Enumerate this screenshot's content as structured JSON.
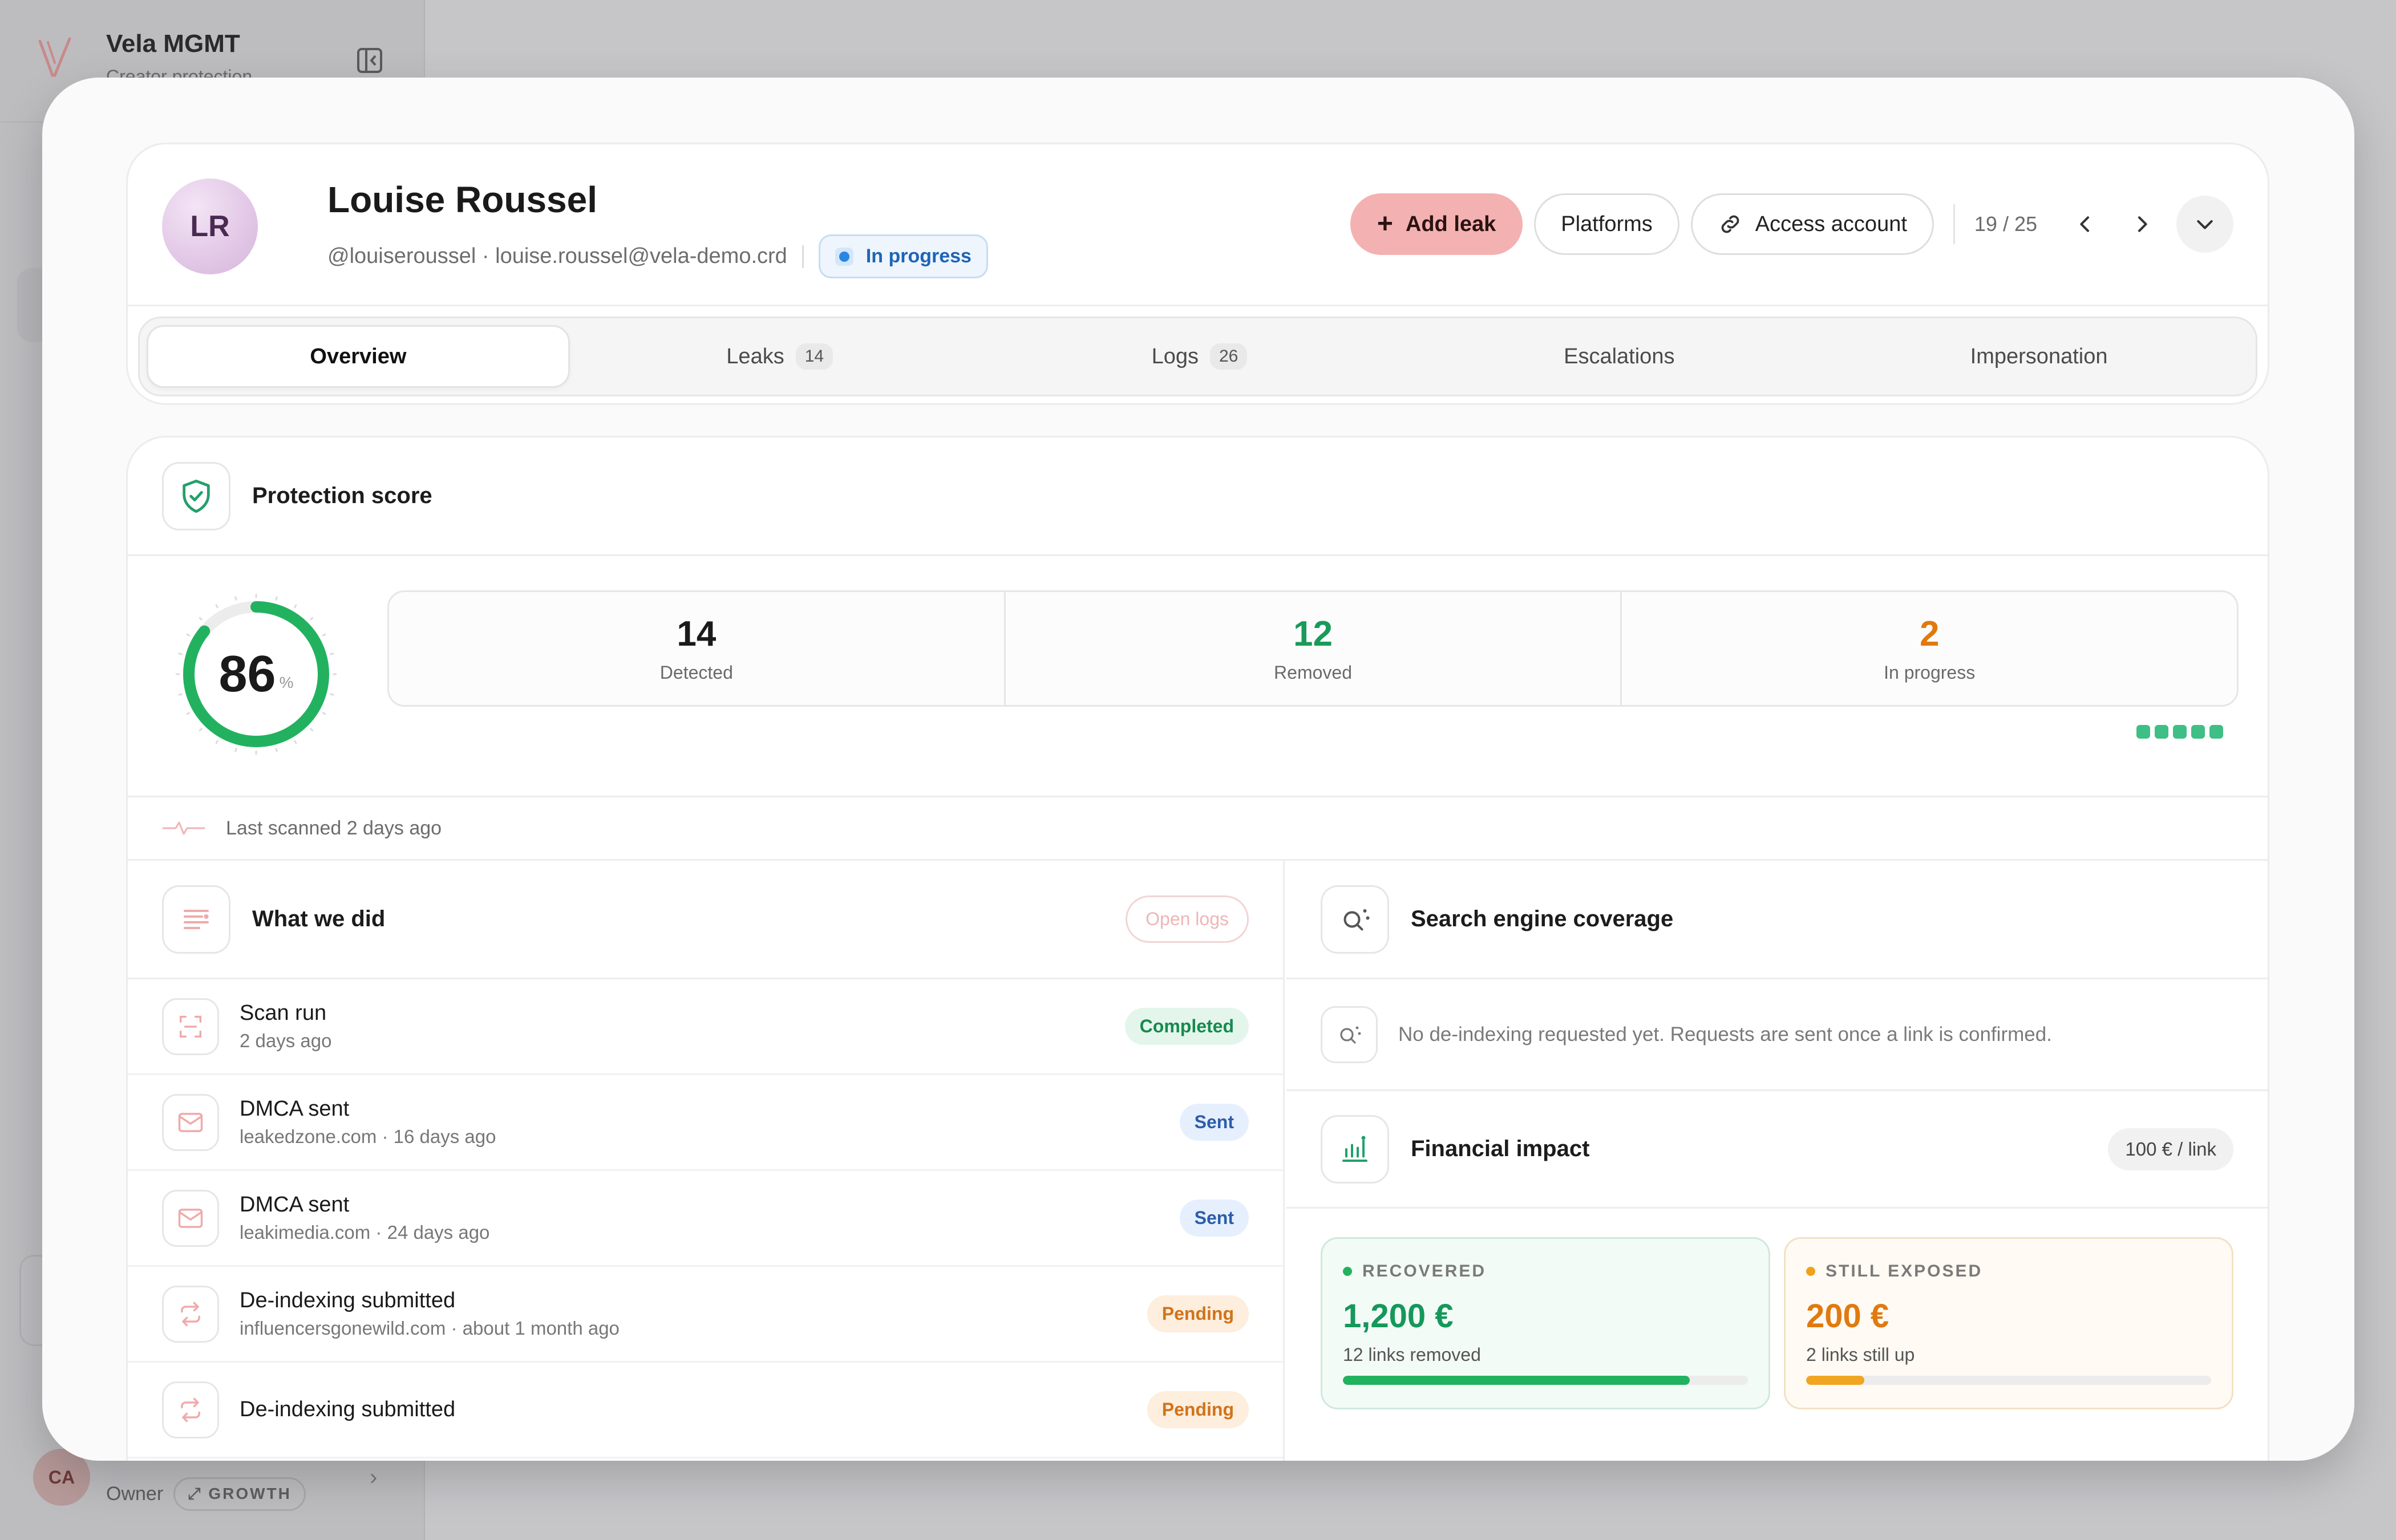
{
  "background": {
    "org_name": "Vela MGMT",
    "org_sub": "Creator protection",
    "user_initials": "CA",
    "user_role": "Owner",
    "user_plan": "GROWTH"
  },
  "profile": {
    "initials": "LR",
    "name": "Louise Roussel",
    "handle": "@louiseroussel · louise.roussel@vela-demo.crd",
    "status": "In progress"
  },
  "actions": {
    "add_leak": "Add leak",
    "platforms": "Platforms",
    "access_account": "Access account",
    "pager": "19 / 25"
  },
  "tabs": [
    {
      "label": "Overview",
      "count": ""
    },
    {
      "label": "Leaks",
      "count": "14"
    },
    {
      "label": "Logs",
      "count": "26"
    },
    {
      "label": "Escalations",
      "count": ""
    },
    {
      "label": "Impersonation",
      "count": ""
    }
  ],
  "protection": {
    "title": "Protection score",
    "score": "86",
    "score_fraction": 0.86,
    "unit": "%",
    "stats": [
      {
        "value": "14",
        "label": "Detected"
      },
      {
        "value": "12",
        "label": "Removed"
      },
      {
        "value": "2",
        "label": "In progress"
      }
    ],
    "last_scanned": "Last scanned 2 days ago"
  },
  "activity": {
    "title": "What we did",
    "open_logs": "Open logs",
    "items": [
      {
        "title": "Scan run",
        "sub": "2 days ago",
        "status": "Completed"
      },
      {
        "title": "DMCA sent",
        "sub": "leakedzone.com · 16 days ago",
        "status": "Sent"
      },
      {
        "title": "DMCA sent",
        "sub": "leakimedia.com · 24 days ago",
        "status": "Sent"
      },
      {
        "title": "De-indexing submitted",
        "sub": "influencersgonewild.com · about 1 month ago",
        "status": "Pending"
      },
      {
        "title": "De-indexing submitted",
        "sub": "",
        "status": "Pending"
      }
    ]
  },
  "search": {
    "title": "Search engine coverage",
    "note": "No de-indexing requested yet. Requests are sent once a link is confirmed."
  },
  "financial": {
    "title": "Financial impact",
    "rate": "100 € / link",
    "recovered_label": "RECOVERED",
    "recovered_amount": "1,200 €",
    "recovered_sub": "12 links removed",
    "recovered_fraction": 0.857,
    "exposed_label": "STILL EXPOSED",
    "exposed_amount": "200 €",
    "exposed_sub": "2 links still up",
    "exposed_fraction": 0.143
  },
  "colors": {
    "accent": "#f4b1b1",
    "green": "#22b25f",
    "orange": "#e07a10",
    "blue": "#2b86e3"
  }
}
